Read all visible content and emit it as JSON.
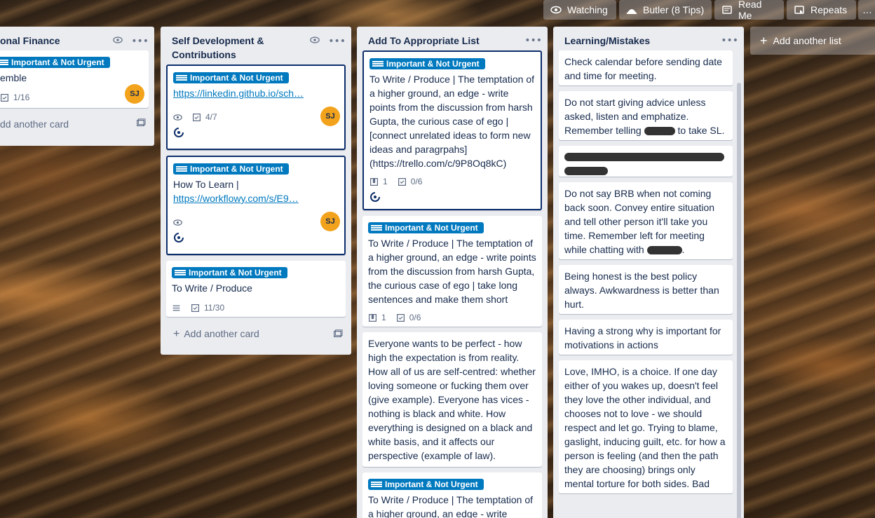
{
  "header": {
    "watching": "Watching",
    "butler": "Butler (8 Tips)",
    "read_me": "Read Me",
    "repeats": "Repeats",
    "more": "…"
  },
  "label_text": "Important & Not Urgent",
  "colors": {
    "label": "#0079bf",
    "avatar": "#f2a31b",
    "list_bg": "#ebecf0",
    "selected_border": "#0d2e6b"
  },
  "lists": [
    {
      "title": "onal Finance",
      "cards": [
        {
          "text": "emble",
          "checklist": "1/16",
          "avatar": "SJ"
        }
      ],
      "add_card": "dd another card"
    },
    {
      "title": "Self Development & Contributions",
      "cards": [
        {
          "link": "https://linkedin.github.io/sch…",
          "checklist": "4/7",
          "avatar": "SJ"
        },
        {
          "text": "How To Learn |",
          "link": "https://workflowy.com/s/E9…",
          "avatar": "SJ"
        },
        {
          "text": "To Write / Produce",
          "checklist": "11/30"
        }
      ],
      "add_card": "Add another card"
    },
    {
      "title": "Add To Appropriate List",
      "cards": [
        {
          "text": "To Write / Produce | The temptation of a higher ground, an edge - write points from the discussion from harsh Gupta, the curious case of ego | [connect unrelated ideas to form new ideas and paragrpahs](https://trello.com/c/9P8Oq8kC)",
          "attachments": "1",
          "checklist": "0/6"
        },
        {
          "text": "To Write / Produce | The temptation of a higher ground, an edge - write points from the discussion from harsh Gupta, the curious case of ego | take long sentences and make them short",
          "attachments": "1",
          "checklist": "0/6"
        },
        {
          "text": "Everyone wants to be perfect - how high the expectation is from reality. How all of us are self-centred: whether loving someone or fucking them over (give example). Everyone has vices - nothing is black and white. How everything is designed on a black and white basis, and it affects our perspective (example of law)."
        },
        {
          "text": "To Write / Produce | The temptation of a higher ground, an edge - write"
        }
      ]
    },
    {
      "title": "Learning/Mistakes",
      "cards": [
        {
          "text": "Check calendar before sending date and time for meeting."
        },
        {
          "text_a": "Do not start giving advice unless asked, listen and emphatize. Remember telling",
          "text_b": "to take SL."
        },
        {
          "text": ""
        },
        {
          "text_a": "Do not say BRB when not coming back soon. Convey entire situation and tell other person it'll take you time. Remember left for meeting while chatting with",
          "text_b": "."
        },
        {
          "text": "Being honest is the best policy always. Awkwardness is better than hurt."
        },
        {
          "text": "Having a strong why is important for motivations in actions"
        },
        {
          "text": "Love, IMHO, is a choice. If one day either of you wakes up, doesn't feel they love the other individual, and chooses not to love - we should respect and let go. Trying to blame, gaslight, inducing guilt, etc. for how a person is feeling (and then the path they are choosing) brings only mental torture for both sides. Bad"
        }
      ]
    }
  ],
  "add_list": "Add another list"
}
